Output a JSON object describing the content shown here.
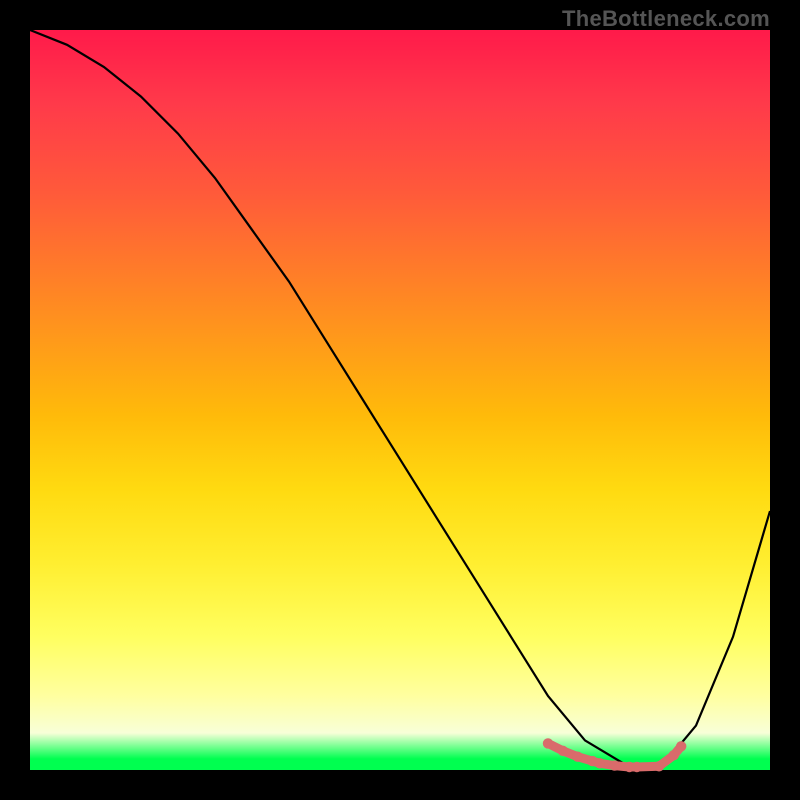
{
  "watermark": "TheBottleneck.com",
  "chart_data": {
    "type": "line",
    "title": "",
    "xlabel": "",
    "ylabel": "",
    "xlim": [
      0,
      100
    ],
    "ylim": [
      0,
      100
    ],
    "grid": false,
    "legend": false,
    "series": [
      {
        "name": "bottleneck-curve",
        "color": "#000000",
        "x": [
          0,
          5,
          10,
          15,
          20,
          25,
          30,
          35,
          40,
          45,
          50,
          55,
          60,
          65,
          70,
          75,
          80,
          82,
          85,
          90,
          95,
          100
        ],
        "y": [
          100,
          98,
          95,
          91,
          86,
          80,
          73,
          66,
          58,
          50,
          42,
          34,
          26,
          18,
          10,
          4,
          1,
          0,
          0,
          6,
          18,
          35
        ]
      },
      {
        "name": "optimal-band",
        "color": "#d96b6b",
        "x": [
          70,
          72,
          74,
          76,
          77,
          79,
          81,
          82,
          85,
          87,
          88
        ],
        "y": [
          3.6,
          2.6,
          1.8,
          1.2,
          0.9,
          0.6,
          0.4,
          0.4,
          0.5,
          2.0,
          3.2
        ]
      }
    ],
    "background_gradient": {
      "top_color": "#ff1a4a",
      "mid_upper_color": "#ff9a1a",
      "mid_lower_color": "#ffff60",
      "bottom_color": "#00ff50"
    }
  }
}
